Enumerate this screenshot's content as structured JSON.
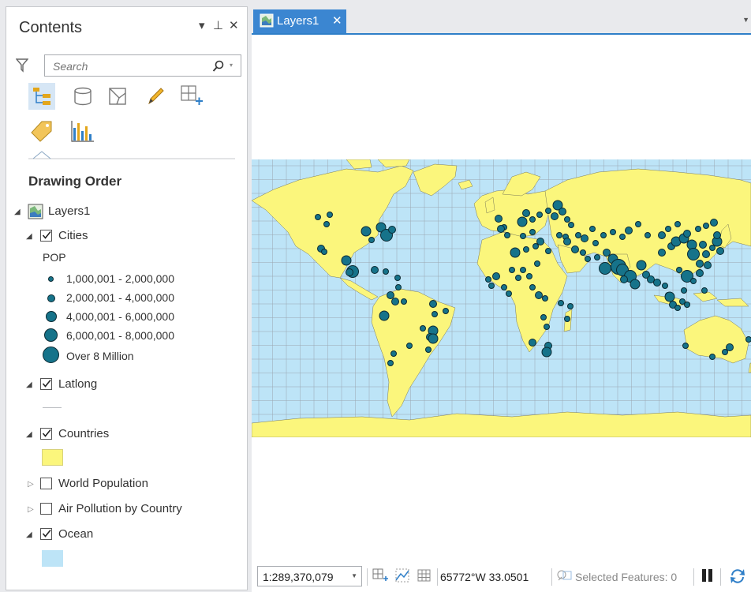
{
  "contents": {
    "title": "Contents",
    "search_placeholder": "Search",
    "section_title": "Drawing Order",
    "tools": [
      "list-by-drawing-order-icon",
      "list-by-source-icon",
      "list-by-selection-icon",
      "list-by-editing-icon",
      "list-by-snapping-icon",
      "list-by-labeling-icon",
      "list-by-charts-icon"
    ],
    "map_name": "Layers1",
    "layers": [
      {
        "name": "Cities",
        "checked": true,
        "expanded": true
      },
      {
        "name": "Latlong",
        "checked": true,
        "expanded": true
      },
      {
        "name": "Countries",
        "checked": true,
        "expanded": true
      },
      {
        "name": "World Population",
        "checked": false,
        "expanded": false
      },
      {
        "name": "Air Pollution by Country",
        "checked": false,
        "expanded": false
      },
      {
        "name": "Ocean",
        "checked": true,
        "expanded": true
      }
    ],
    "cities_legend": {
      "field": "POP",
      "classes": [
        "1,000,001 - 2,000,000",
        "2,000,001 - 4,000,000",
        "4,000,001 - 6,000,000",
        "6,000,001 - 8,000,000",
        "Over 8 Million"
      ]
    },
    "colors": {
      "countries": "#fbf67c",
      "ocean": "#bde4f7",
      "city": "#16738a"
    }
  },
  "map_view": {
    "tab_label": "Layers1",
    "status": {
      "scale": "1:289,370,079",
      "coordinates": "65772°W 33.0501",
      "selected_features": "Selected Features: 0"
    }
  }
}
